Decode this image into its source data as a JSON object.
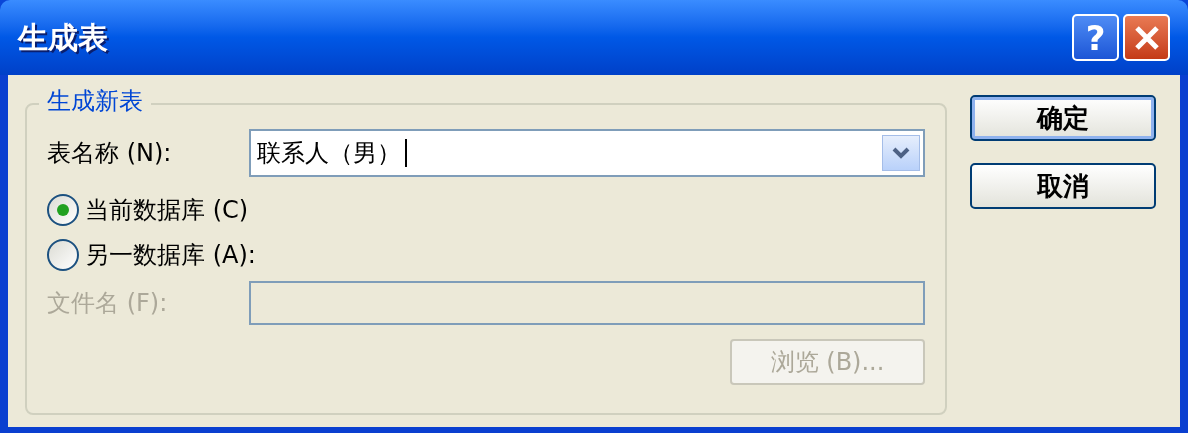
{
  "window": {
    "title": "生成表",
    "help_button": "?"
  },
  "group": {
    "legend": "生成新表",
    "table_name": {
      "label": "表名称 (N):",
      "value": "联系人（男）"
    },
    "options": [
      {
        "label": "当前数据库 (C)",
        "selected": true
      },
      {
        "label": "另一数据库 (A):",
        "selected": false
      }
    ],
    "file_name": {
      "label": "文件名 (F):",
      "disabled": true
    },
    "browse_button": {
      "label": "浏览 (B)...",
      "disabled": true
    }
  },
  "buttons": [
    {
      "label": "确定",
      "default": true
    },
    {
      "label": "取消",
      "default": false
    }
  ]
}
